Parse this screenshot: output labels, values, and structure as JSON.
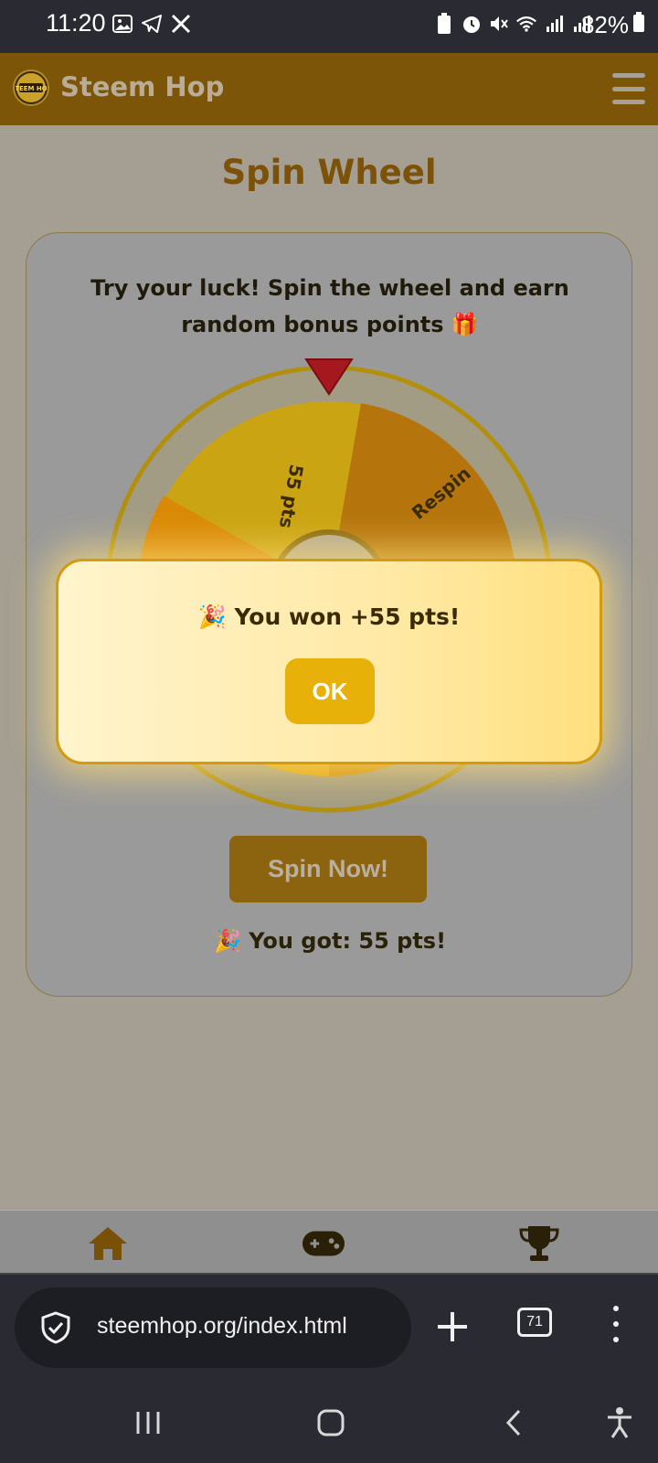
{
  "status_bar": {
    "time": "11:20",
    "battery_percent": "82%"
  },
  "header": {
    "brand": "Steem Hop",
    "logo_text": "STEEM HOP"
  },
  "page": {
    "title": "Spin Wheel",
    "description": "Try your luck! Spin the wheel and earn random bonus points 🎁"
  },
  "wheel": {
    "segments": [
      {
        "label": "55 pts",
        "color": "#c9a210"
      },
      {
        "label": "Respin",
        "color": "#b5750c"
      }
    ]
  },
  "spin_button": {
    "label": "Spin Now!"
  },
  "result": {
    "text": "🎉 You got: 55 pts!"
  },
  "popup": {
    "message": "🎉 You won +55 pts!",
    "ok_label": "OK"
  },
  "bottom_nav": {
    "items": [
      "home-icon",
      "gamepad-icon",
      "trophy-icon"
    ]
  },
  "browser": {
    "url": "steemhop.org/index.html",
    "tab_count": "71"
  },
  "colors": {
    "accent": "#e7b10a",
    "header_bg": "#7c5509",
    "title_color": "#7b5208"
  }
}
